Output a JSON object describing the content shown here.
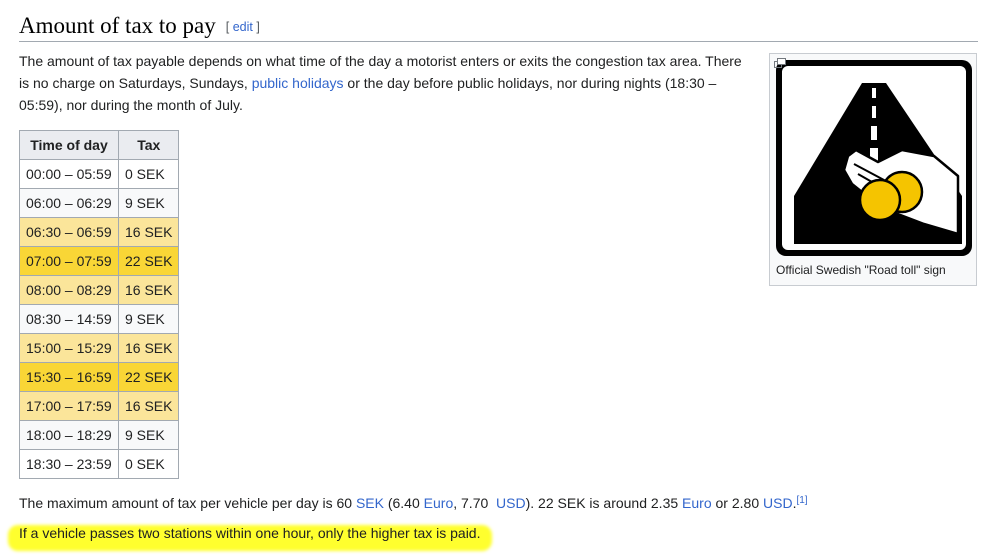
{
  "section": {
    "title": "Amount of tax to pay",
    "edit_open": "[ ",
    "edit_label": "edit",
    "edit_close": " ]"
  },
  "intro": {
    "part1": "The amount of tax payable depends on what time of the day a motorist enters or exits the congestion tax area. There is no charge on Saturdays, Sundays, ",
    "link": "public holidays",
    "part2": " or the day before public holidays, nor during nights (18:30 – 05:59), nor during the month of July."
  },
  "table": {
    "headers": [
      "Time of day",
      "Tax"
    ],
    "rows": [
      {
        "time": "00:00 – 05:59",
        "tax": "0 SEK"
      },
      {
        "time": "06:00 – 06:29",
        "tax": "9 SEK"
      },
      {
        "time": "06:30 – 06:59",
        "tax": "16 SEK"
      },
      {
        "time": "07:00 – 07:59",
        "tax": "22 SEK"
      },
      {
        "time": "08:00 – 08:29",
        "tax": "16 SEK"
      },
      {
        "time": "08:30 – 14:59",
        "tax": "9 SEK"
      },
      {
        "time": "15:00 – 15:29",
        "tax": "16 SEK"
      },
      {
        "time": "15:30 – 16:59",
        "tax": "22 SEK"
      },
      {
        "time": "17:00 – 17:59",
        "tax": "16 SEK"
      },
      {
        "time": "18:00 – 18:29",
        "tax": "9 SEK"
      },
      {
        "time": "18:30 – 23:59",
        "tax": "0 SEK"
      }
    ],
    "row_colors": {
      "zero": "#ffffff",
      "low": "#f8f9fa",
      "mid": "#fbe59a",
      "high": "#f9d636"
    }
  },
  "image": {
    "icon": "road-toll-sign-icon",
    "caption": "Official Swedish \"Road toll\" sign",
    "enlarge_icon": "enlarge-icon"
  },
  "para2": {
    "t1": "The maximum amount of tax per vehicle per day is 60 ",
    "sek": "SEK",
    "t2": " (6.40 ",
    "euro1": "Euro",
    "t3": ", 7.70  ",
    "usd1": "USD",
    "t4": "). 22 SEK is around 2.35 ",
    "euro2": "Euro",
    "t5": " or 2.80 ",
    "usd2": "USD",
    "t6": ".",
    "ref": "[1]"
  },
  "para3": {
    "text": "If a vehicle passes two stations within one hour, only the higher tax is paid.",
    "highlight_color": "#ffff2e"
  }
}
